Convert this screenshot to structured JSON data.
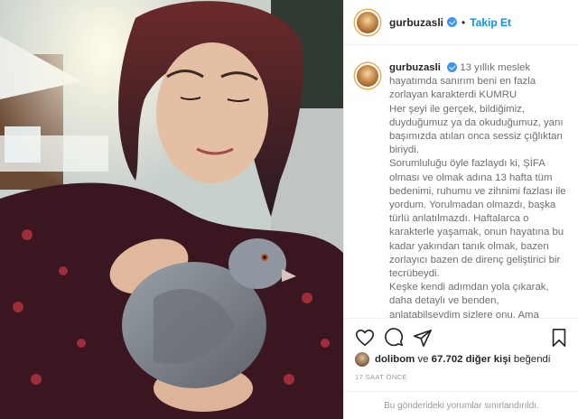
{
  "post": {
    "username": "gurbuzasli",
    "follow_label": "Takip Et",
    "separator": "•",
    "caption": {
      "username": "gurbuzasli",
      "paragraphs": [
        "13 yıllık meslek hayatımda sanırım beni en fazla zorlayan karakterdi KUMRU",
        "Her şeyi ile gerçek, bildiğimiz, duyduğumuz ya da okuduğumuz, yanı başımızda atılan onca sessiz çığlıktan biriydi.",
        "Sorumluluğu öyle fazlaydı ki, ŞİFA olması ve olmak adına 13 hafta tüm bedenimi, ruhumu ve zihnimi fazlası ile yordum. Yorulmadan olmazdı, başka türlü anlatılmazdı. Haftalarca o karakterle yaşamak, onun hayatına bu kadar yakından tanık olmak, bazen zorlayıcı bazen de direnç geliştirici bir tecrübeydi.",
        "Keşke kendi adımdan yola çıkarak, daha detaylı ve benden, anlatabilseydim sizlere onu. Ama magazin deneni oluş hiç yapmadığım"
      ]
    },
    "likes": {
      "first_liker": "dolibom",
      "joiner": " ve ",
      "others": "67.702 diğer kişi",
      "suffix": " beğendi"
    },
    "time": "17 SAAT ÖNCE",
    "comments_note": "Bu gönderideki yorumlar sınırlandırıldı.",
    "icons": {
      "like": "heart-icon",
      "comment": "comment-icon",
      "share": "share-icon",
      "save": "bookmark-icon"
    },
    "colors": {
      "follow_blue": "#0095f6",
      "verified_blue": "#3897f0"
    }
  }
}
